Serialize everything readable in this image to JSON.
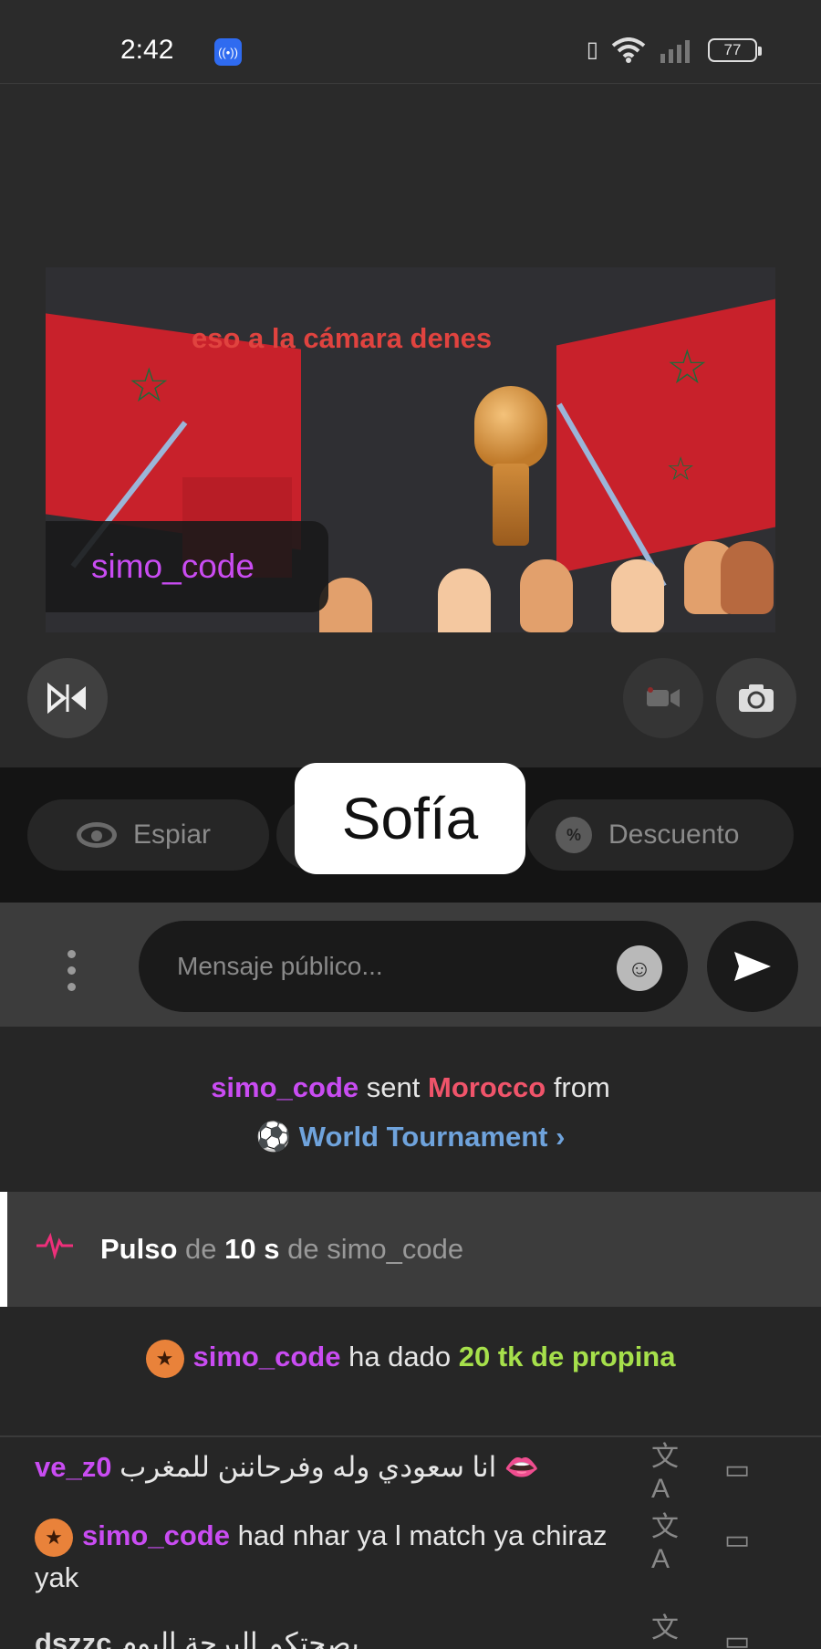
{
  "status_bar": {
    "time": "2:42",
    "battery": "77"
  },
  "stream": {
    "banner_text": "eso a la cámara denes",
    "name_tag": "simo_code"
  },
  "actions": {
    "spy_label": "Espiar",
    "discount_label": "Descuento",
    "discount_icon": "%",
    "tooltip": "Sofía"
  },
  "composer": {
    "placeholder": "Mensaje público..."
  },
  "chat": {
    "gift_message": {
      "user": "simo_code",
      "verb": "sent",
      "gift": "Morocco",
      "from_word": "from",
      "source_emoji": "⚽",
      "source": "World Tournament"
    },
    "pulse": {
      "label": "Pulso",
      "de1": "de",
      "duration": "10 s",
      "de2": "de",
      "user": "simo_code"
    },
    "tip": {
      "user": "simo_code",
      "text": "ha dado",
      "amount": "20 tk de propina"
    },
    "messages": [
      {
        "user": "ve_z0",
        "text": "انا سعودي وله وفرحاننن للمغرب 👄"
      },
      {
        "user": "simo_code",
        "text": "had nhar ya l match ya chiraz yak"
      },
      {
        "user": "dszzc",
        "text": "بصحتكم البرحة اليوم"
      }
    ]
  }
}
